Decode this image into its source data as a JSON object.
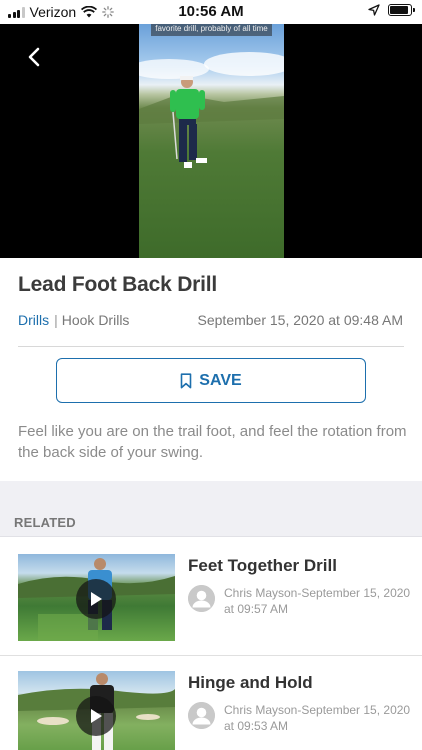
{
  "status_bar": {
    "carrier": "Verizon",
    "time": "10:56 AM",
    "battery_level": 0.9,
    "icons": [
      "cellular-signal-icon",
      "wifi-icon",
      "loading-spinner-icon",
      "location-arrow-icon",
      "battery-icon"
    ]
  },
  "video": {
    "caption": "favorite drill, probably of all time",
    "back_icon": "chevron-left-icon"
  },
  "drill": {
    "title": "Lead Foot Back Drill",
    "category_link": "Drills",
    "separator": "|",
    "subcategory": "Hook Drills",
    "date": "September 15, 2020 at 09:48 AM",
    "save_label": "SAVE",
    "save_icon": "bookmark-icon",
    "description": "Feel like you are on the trail foot, and feel the rotation from the back side of your swing."
  },
  "related": {
    "heading": "RELATED",
    "items": [
      {
        "title": "Feet Together Drill",
        "meta": "Chris Mayson-September 15, 2020 at 09:57 AM",
        "icon": "play-icon"
      },
      {
        "title": "Hinge and Hold",
        "meta": "Chris Mayson-September 15, 2020 at 09:53 AM",
        "icon": "play-icon"
      }
    ]
  },
  "colors": {
    "accent": "#1d6fad",
    "title_text": "#3b3b3b",
    "muted_text": "#8b8b8b",
    "section_bg": "#f0f0f4"
  }
}
